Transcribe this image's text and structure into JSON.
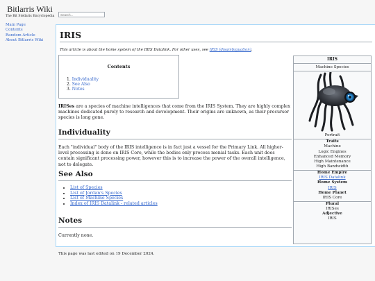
{
  "site": {
    "title": "Bitlarris Wiki",
    "tagline": "The Bit Stellaris Encyclopedia"
  },
  "search": {
    "placeholder": "Search..."
  },
  "sidebar": {
    "items": [
      {
        "label": "Main Page"
      },
      {
        "label": "Contents"
      },
      {
        "label": "Random Article"
      },
      {
        "label": "About Bitlarris Wiki"
      }
    ]
  },
  "article": {
    "title": "IRIS",
    "hatnote_prefix": "This article is about the home system of the IRIS Datalink. For other uses, see ",
    "hatnote_link": "IRIS (disambiguation)",
    "hatnote_suffix": ".",
    "toc": {
      "title": "Contents",
      "items": [
        {
          "num": "1.",
          "label": "Individuality"
        },
        {
          "num": "2.",
          "label": "See Also"
        },
        {
          "num": "3.",
          "label": "Notes"
        }
      ]
    },
    "intro_bold": "IRISes",
    "intro_rest": " are a species of machine intelligences that come from the IRIS System. They are highly complex machines dedicated purely to research and development. Their origins are unknown, as their precursor species is long gone.",
    "sections": {
      "individuality": {
        "heading": "Individuality",
        "text": "Each \"individual\" body of the IRIS intelligence is in fact just a vessel for the Primary Link. All higher-level processing is done on IRIS Core, while the bodies only process menial tasks. Each unit does contain significant processing power, however this is to increase the power of the overall intelligence, not to delegate."
      },
      "see_also": {
        "heading": "See Also",
        "links": [
          {
            "label": "List of Species"
          },
          {
            "label": "List of Jordan's Species"
          },
          {
            "label": "List of Machine Species"
          },
          {
            "label": "Index of IRIS Datalink - related articles"
          }
        ]
      },
      "notes": {
        "heading": "Notes",
        "text": "Currently none."
      }
    },
    "footer": "This page was last edited on 19 December 2024."
  },
  "infobox": {
    "title": "IRIS",
    "subtitle": "Machine Species",
    "caption": "Portrait",
    "traits_head": "Traits",
    "traits": [
      "Machine",
      "Logic Engines",
      "Enhanced Memory",
      "High Maintenance",
      "High Bandwidth"
    ],
    "home_empire_head": "Home Empire",
    "home_empire": "IRIS Datalink",
    "home_system_head": "Home System",
    "home_system": "IRIS",
    "home_planet_head": "Home Planet",
    "home_planet": "IRIS Core",
    "plural_head": "Plural",
    "plural": "IRISes",
    "adjective_head": "Adjective",
    "adjective": "IRIS"
  },
  "colors": {
    "link": "#3366cc",
    "content_border": "#a7d7f9",
    "divider": "#a2a9b1",
    "page_bg": "#f6f6f6",
    "portrait_eye": "#2a8fd6"
  },
  "icons": {
    "portrait": "machine-portrait-image"
  }
}
